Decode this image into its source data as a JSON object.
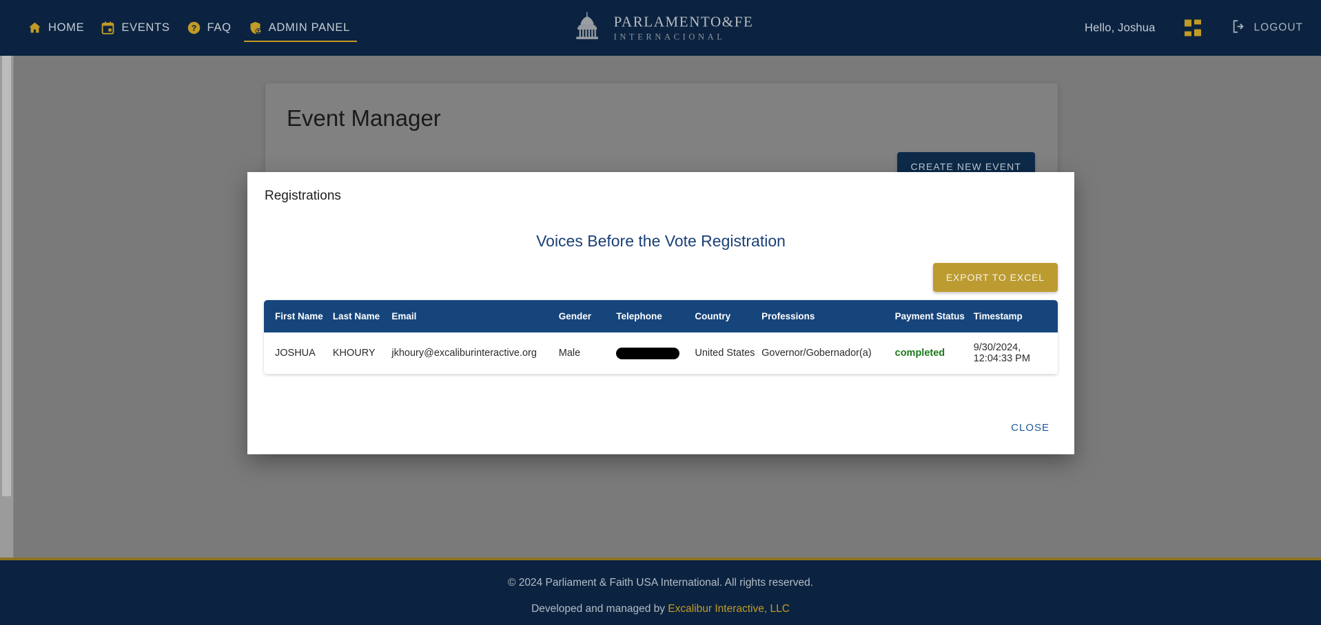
{
  "nav": {
    "items": [
      {
        "label": "HOME",
        "icon": "home-icon",
        "active": false
      },
      {
        "label": "EVENTS",
        "icon": "calendar-icon",
        "active": false
      },
      {
        "label": "FAQ",
        "icon": "question-circle-icon",
        "active": false
      },
      {
        "label": "ADMIN PANEL",
        "icon": "shield-user-icon",
        "active": true
      }
    ],
    "logo_main": "PARLAMENTO&FE",
    "logo_sub": "INTERNACIONAL",
    "logo_icon": "capitol-building-icon",
    "greeting": "Hello, Joshua",
    "grid_icon": "apps-grid-icon",
    "logout_icon": "logout-arrow-icon",
    "logout_label": "LOGOUT"
  },
  "page": {
    "title": "Event Manager",
    "create_button": "CREATE NEW EVENT"
  },
  "modal": {
    "title": "Registrations",
    "event_title": "Voices Before the Vote Registration",
    "export_button": "EXPORT TO EXCEL",
    "close_button": "CLOSE",
    "table": {
      "columns": [
        "First Name",
        "Last Name",
        "Email",
        "Gender",
        "Telephone",
        "Country",
        "Professions",
        "Payment Status",
        "Timestamp"
      ],
      "rows": [
        {
          "first_name": "JOSHUA",
          "last_name": "KHOURY",
          "email": "jkhoury@excaliburinteractive.org",
          "gender": "Male",
          "telephone": "",
          "telephone_redacted": true,
          "country": "United States",
          "professions": "Governor/Gobernador(a)",
          "payment_status": "completed",
          "timestamp": "9/30/2024, 12:04:33 PM"
        }
      ]
    }
  },
  "footer": {
    "copyright": "© 2024 Parliament & Faith USA International. All rights reserved.",
    "developed_prefix": "Developed and managed by ",
    "developed_link": "Excalibur Interactive, LLC"
  },
  "colors": {
    "navy": "#0b2340",
    "gold": "#c29b26",
    "table_header": "#16457c",
    "accent_blue": "#1a3f77",
    "status_green": "#1a7a1a",
    "overlay_gray": "#7a7a7a"
  }
}
